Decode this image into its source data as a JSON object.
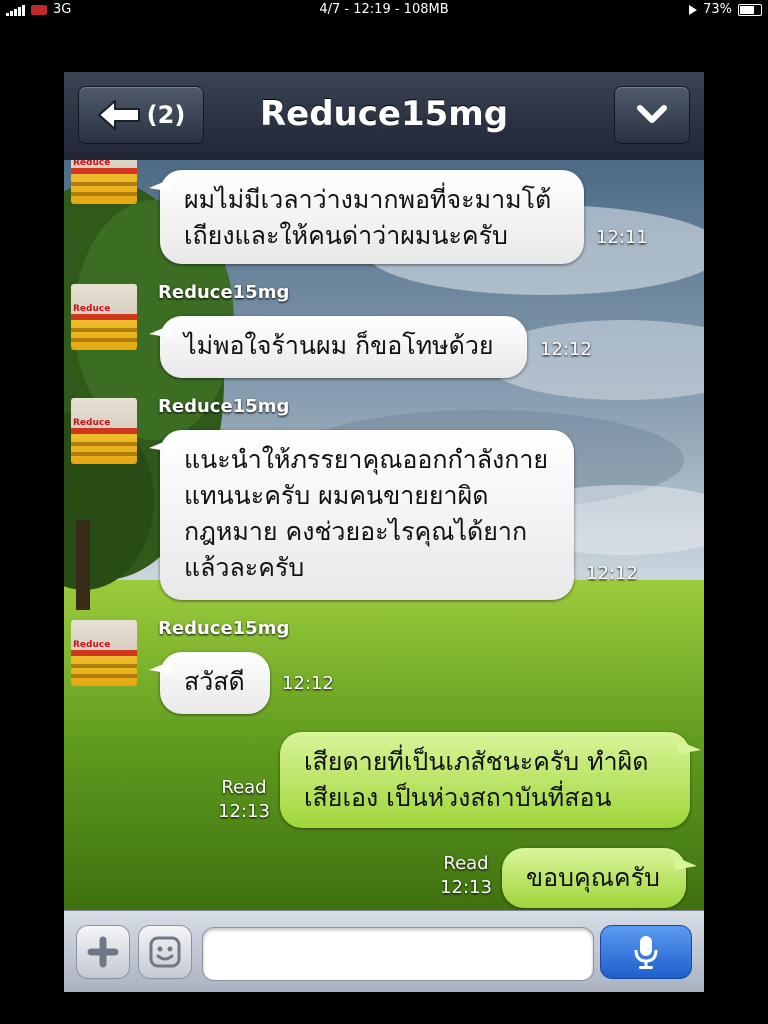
{
  "status_bar": {
    "network": "3G",
    "center": "4/7 - 12:19 - 108MB",
    "battery": "73%"
  },
  "header": {
    "back_label": "(2)",
    "title": "Reduce15mg"
  },
  "messages": [
    {
      "direction": "in",
      "text_lines": [
        "ผมไม่มีเวลาว่างมากพอที่จะมามโต้",
        "เถียงและให้คนด่าว่าผมนะครับ"
      ],
      "time": "12:11"
    },
    {
      "direction": "in",
      "sender": "Reduce15mg",
      "text_lines": [
        "ไม่พอใจร้านผม ก็ขอโทษด้วย"
      ],
      "time": "12:12"
    },
    {
      "direction": "in",
      "sender": "Reduce15mg",
      "text_lines": [
        "แนะนำให้ภรรยาคุณออกกำลังกาย",
        "แทนนะครับ ผมคนขายยาผิด",
        "กฎหมาย คงช่วยอะไรคุณได้ยาก",
        "แล้วละครับ"
      ],
      "time": "12:12"
    },
    {
      "direction": "in",
      "sender": "Reduce15mg",
      "text_lines": [
        "สวัสดี"
      ],
      "time": "12:12"
    },
    {
      "direction": "out",
      "text_lines": [
        "เสียดายที่เป็นเภสัชนะครับ ทำผิด",
        "เสียเอง เป็นห่วงสถาบันที่สอน"
      ],
      "status": "Read",
      "time": "12:13"
    },
    {
      "direction": "out",
      "text_lines": [
        "ขอบคุณครับ"
      ],
      "status": "Read",
      "time": "12:13"
    }
  ],
  "avatar_text": "Reduce",
  "input": {
    "value": "",
    "placeholder": ""
  },
  "colors": {
    "header": "#2a3240",
    "outgoing_bubble": "#b8e35e",
    "incoming_bubble": "#ffffff",
    "send_button": "#2d6fd8"
  },
  "icons": [
    "back-arrow-icon",
    "chevron-down-icon",
    "plus-icon",
    "emoticon-icon",
    "microphone-icon"
  ]
}
